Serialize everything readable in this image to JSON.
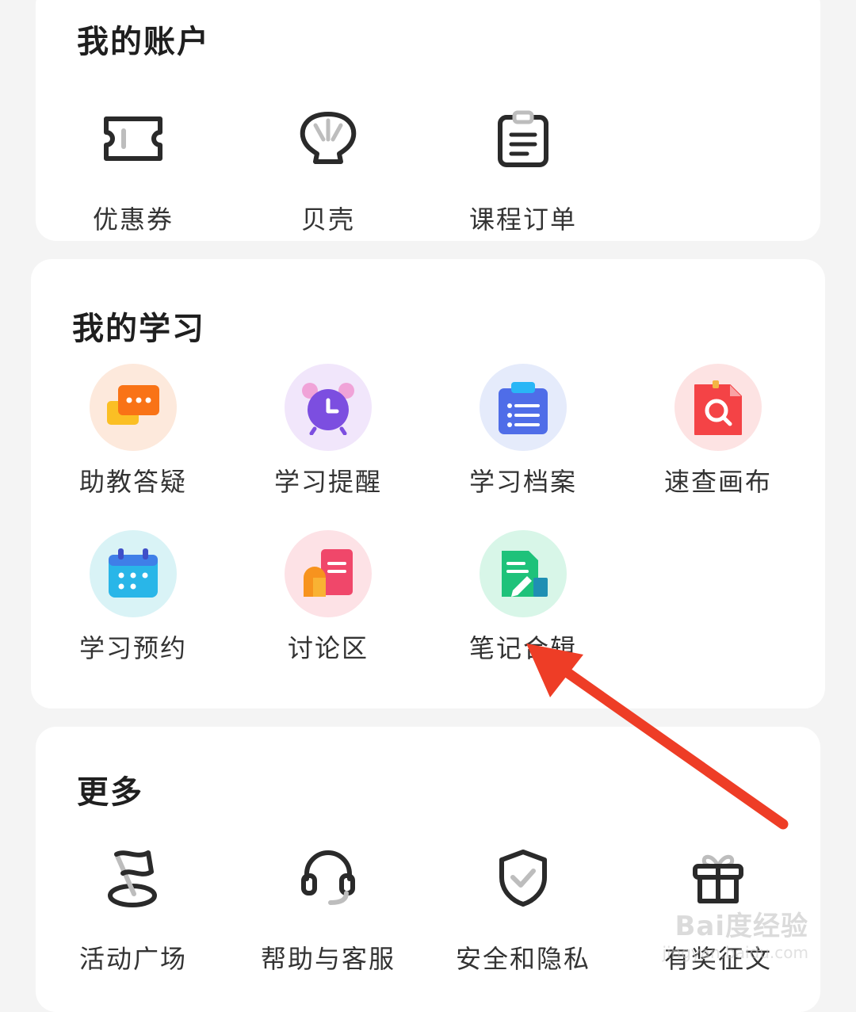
{
  "account": {
    "title": "我的账户",
    "items": [
      {
        "label": "优惠券",
        "icon": "ticket-icon"
      },
      {
        "label": "贝壳",
        "icon": "shell-icon"
      },
      {
        "label": "课程订单",
        "icon": "clipboard-icon"
      }
    ]
  },
  "learning": {
    "title": "我的学习",
    "items": [
      {
        "label": "助教答疑",
        "icon": "chat-bubbles-icon"
      },
      {
        "label": "学习提醒",
        "icon": "alarm-clock-icon"
      },
      {
        "label": "学习档案",
        "icon": "archive-list-icon"
      },
      {
        "label": "速查画布",
        "icon": "search-document-icon"
      },
      {
        "label": "学习预约",
        "icon": "calendar-icon"
      },
      {
        "label": "讨论区",
        "icon": "discussion-icon"
      },
      {
        "label": "笔记合辑",
        "icon": "notes-icon"
      }
    ]
  },
  "more": {
    "title": "更多",
    "items": [
      {
        "label": "活动广场",
        "icon": "flag-icon"
      },
      {
        "label": "帮助与客服",
        "icon": "headset-icon"
      },
      {
        "label": "安全和隐私",
        "icon": "shield-check-icon"
      },
      {
        "label": "有奖征文",
        "icon": "gift-icon"
      }
    ]
  },
  "watermark": {
    "main": "Bai度经验",
    "sub": "jingyan.baidu.com"
  },
  "colors": {
    "arrow": "#ee3d26",
    "card": "#ffffff",
    "background": "#f4f4f4"
  }
}
